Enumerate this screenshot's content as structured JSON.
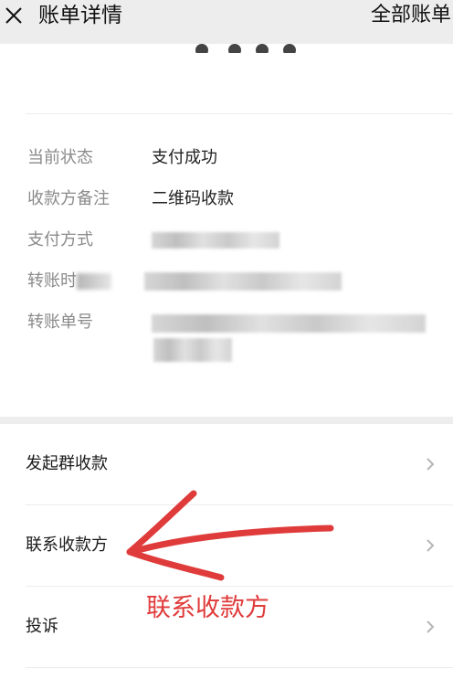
{
  "header": {
    "close_icon": "close-x-icon",
    "title": "账单详情",
    "all_bills_label": "全部账单"
  },
  "details": [
    {
      "label": "当前状态",
      "value": "支付成功"
    },
    {
      "label": "收款方备注",
      "value": "二维码收款"
    },
    {
      "label": "支付方式",
      "value": ""
    },
    {
      "label": "转账时",
      "value": ""
    },
    {
      "label": "转账单号",
      "value": ""
    }
  ],
  "actions": [
    {
      "label": "发起群收款",
      "icon": "chevron-right-icon"
    },
    {
      "label": "联系收款方",
      "icon": "chevron-right-icon"
    },
    {
      "label": "投诉",
      "icon": "chevron-right-icon"
    }
  ],
  "annotation": {
    "text": "联系收款方",
    "color": "#e03b3b",
    "icon": "hand-drawn-arrow-icon"
  },
  "colors": {
    "background": "#ededed",
    "card": "#ffffff",
    "label_gray": "#8a8a8a",
    "annotation_red": "#e03b3b"
  }
}
